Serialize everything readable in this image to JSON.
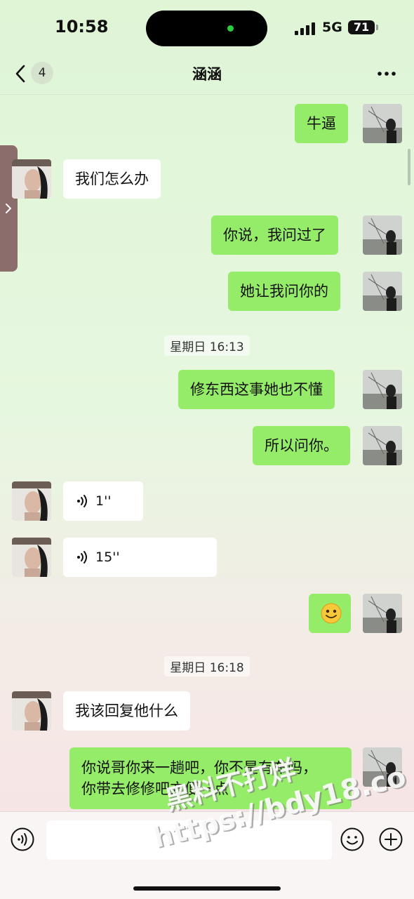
{
  "status": {
    "time": "10:58",
    "network": "5G",
    "battery": "71"
  },
  "nav": {
    "title": "涵涵",
    "unread_badge": "4"
  },
  "messages": [
    {
      "from": "me",
      "type": "text",
      "text": "牛逼"
    },
    {
      "from": "other",
      "type": "text",
      "text": "我们怎么办"
    },
    {
      "from": "me",
      "type": "text",
      "text": "你说，我问过了"
    },
    {
      "from": "me",
      "type": "text",
      "text": "她让我问你的"
    },
    {
      "type": "timestamp",
      "text": "星期日 16:13"
    },
    {
      "from": "me",
      "type": "text",
      "text": "修东西这事她也不懂"
    },
    {
      "from": "me",
      "type": "text",
      "text": "所以问你。"
    },
    {
      "from": "other",
      "type": "voice",
      "duration": "1''"
    },
    {
      "from": "other",
      "type": "voice",
      "duration": "15''"
    },
    {
      "from": "me",
      "type": "emoji",
      "emoji": "smile-emoji"
    },
    {
      "type": "timestamp",
      "text": "星期日 16:18"
    },
    {
      "from": "other",
      "type": "text",
      "text": "我该回复他什么"
    },
    {
      "from": "me",
      "type": "text",
      "lines": [
        "你说哥你来一趟吧，你不是有车吗，",
        "你带去修修吧方便一点"
      ]
    }
  ],
  "input": {
    "placeholder": ""
  },
  "watermark": {
    "line1": "黑料不打烊",
    "line2": "https://bdy18.co"
  },
  "colors": {
    "my_bubble": "#95ec69",
    "other_bubble": "#ffffff"
  }
}
